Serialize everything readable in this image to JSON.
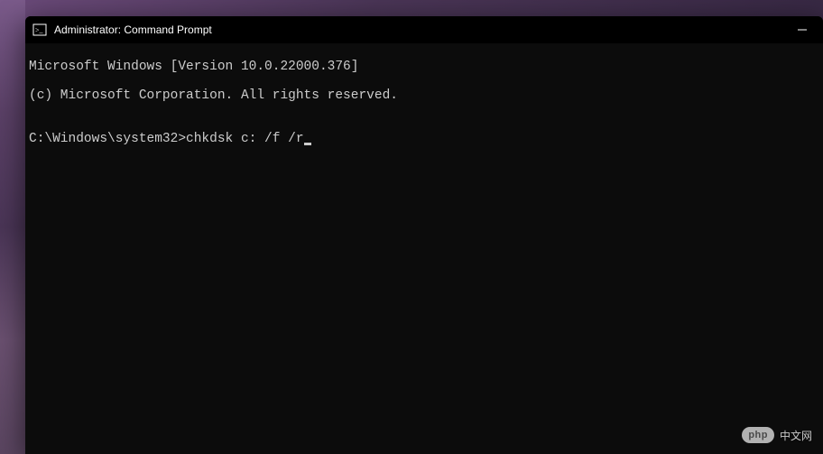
{
  "window": {
    "title": "Administrator: Command Prompt"
  },
  "terminal": {
    "line1": "Microsoft Windows [Version 10.0.22000.376]",
    "line2": "(c) Microsoft Corporation. All rights reserved.",
    "blank": "",
    "prompt": "C:\\Windows\\system32>",
    "command": "chkdsk c: /f /r"
  },
  "watermark": {
    "badge": "php",
    "text": "中文网"
  }
}
